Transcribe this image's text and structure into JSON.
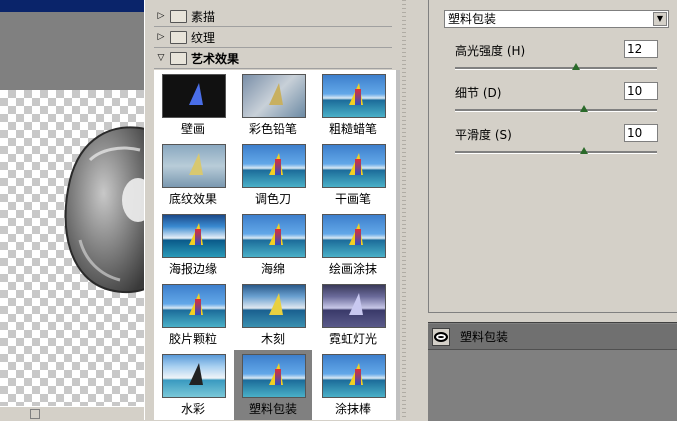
{
  "gallery": {
    "categories": [
      {
        "label": "素描",
        "expanded": false
      },
      {
        "label": "纹理",
        "expanded": false
      },
      {
        "label": "艺术效果",
        "expanded": true
      }
    ],
    "filters": [
      {
        "label": "壁画"
      },
      {
        "label": "彩色铅笔"
      },
      {
        "label": "粗糙蜡笔"
      },
      {
        "label": "底纹效果"
      },
      {
        "label": "调色刀"
      },
      {
        "label": "干画笔"
      },
      {
        "label": "海报边缘"
      },
      {
        "label": "海绵"
      },
      {
        "label": "绘画涂抹"
      },
      {
        "label": "胶片颗粒"
      },
      {
        "label": "木刻"
      },
      {
        "label": "霓虹灯光"
      },
      {
        "label": "水彩"
      },
      {
        "label": "塑料包装",
        "selected": true
      },
      {
        "label": "涂抹棒"
      }
    ]
  },
  "settings": {
    "filter_select": "塑料包装",
    "params": [
      {
        "label": "高光强度 (H)",
        "value": "12",
        "fraction": 0.6
      },
      {
        "label": "细节 (D)",
        "value": "10",
        "fraction": 0.64
      },
      {
        "label": "平滑度 (S)",
        "value": "10",
        "fraction": 0.64
      }
    ]
  },
  "layers": {
    "items": [
      {
        "name": "塑料包装"
      }
    ]
  },
  "colors": {
    "panel_bg": "#d4d0c8",
    "selected_thumb_bg": "#808080",
    "slider_knob": "#2a6a2a",
    "title_bar": "#0a246a"
  }
}
